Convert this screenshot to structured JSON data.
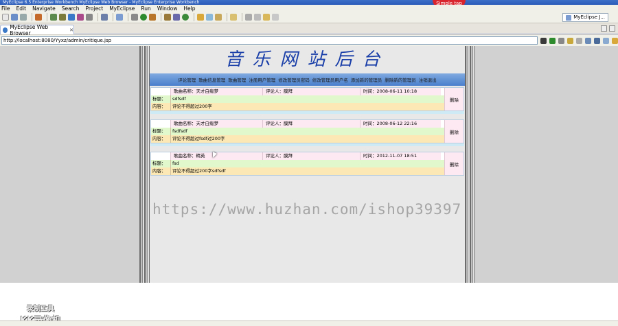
{
  "window": {
    "title": "MyEclipse 6.5 Enterprise Workbench   MyEclipse Web Browser - MyEclipse Enterprise Workbench"
  },
  "recorder_badge": "Simple tap",
  "menu": [
    "File",
    "Edit",
    "Navigate",
    "Search",
    "Project",
    "MyEclipse",
    "Run",
    "Window",
    "Help"
  ],
  "perspective": {
    "label": "MyEclipse J..."
  },
  "tab": {
    "label": "MyEclipse Web Browser",
    "close": "✕"
  },
  "address": {
    "url": "http://localhost:8080/Yyxz/admin/critique.jsp"
  },
  "site": {
    "title": "音乐网站后台",
    "nav": [
      "评论管理",
      "歌曲信息管理",
      "歌曲管理",
      "注册用户管理",
      "修改管理员密码",
      "修改管理员用户名",
      "添加新的管理员",
      "删除新的管理员",
      "注销退出"
    ]
  },
  "labels": {
    "song": "歌曲名称：",
    "commenter": "评论人：",
    "time": "时间：",
    "subject": "标题：",
    "content": "内容：",
    "delete": "删除"
  },
  "records": [
    {
      "song": "天才白痴梦",
      "commenter": "膜拜",
      "time": "2008-06-11 10:18",
      "subject": "sdfsdf",
      "content": "评论不得超过200字"
    },
    {
      "song": "天才白痴梦",
      "commenter": "膜拜",
      "time": "2008-06-12 22:16",
      "subject": "fsdfsdf",
      "content": "评论不得超过fsdf过200字"
    },
    {
      "song": "精英",
      "commenter": "膜拜",
      "time": "2012-11-07 18:51",
      "subject": "fsd",
      "content": "评论不得超过200字sdfsdf"
    }
  ],
  "watermark": "https://www.huzhan.com/ishop39397",
  "logo": {
    "line1": "录制工具",
    "line2": "KK录像机"
  }
}
